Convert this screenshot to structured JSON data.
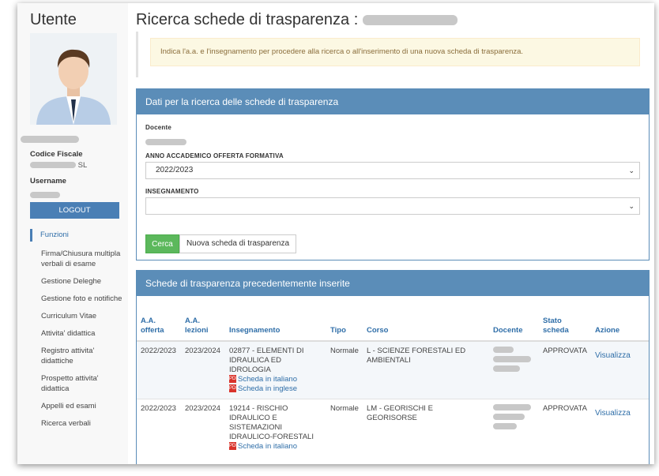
{
  "sidebar": {
    "title": "Utente",
    "codice_fiscale_label": "Codice Fiscale",
    "codice_fiscale_value": "SL",
    "username_label": "Username",
    "logout_label": "LOGOUT",
    "menu_header": "Funzioni",
    "menu_items": [
      "Firma/Chiusura multipla verbali di esame",
      "Gestione Deleghe",
      "Gestione foto e notifiche",
      "Curriculum Vitae",
      "Attivita' didattica",
      "Registro attivita' didattiche",
      "Prospetto attivita' didattica",
      "Appelli ed esami",
      "Ricerca verbali"
    ]
  },
  "main": {
    "title": "Ricerca schede di trasparenza :",
    "alert": "Indica l'a.a. e l'insegnamento per procedere alla ricerca o all'inserimento di una nuova scheda di trasparenza.",
    "search_panel": {
      "heading": "Dati per la ricerca delle schede di trasparenza",
      "docente_label": "Docente",
      "anno_label": "ANNO ACCADEMICO OFFERTA FORMATIVA",
      "anno_value": "2022/2023",
      "insegnamento_label": "INSEGNAMENTO",
      "insegnamento_value": "",
      "cerca_label": "Cerca",
      "new_label": "Nuova scheda di trasparenza"
    },
    "list_panel": {
      "heading": "Schede di trasparenza precedentemente inserite",
      "columns": {
        "aa_offerta": "A.A. offerta",
        "aa_lezioni": "A.A. lezioni",
        "insegnamento": "Insegnamento",
        "tipo": "Tipo",
        "corso": "Corso",
        "docente": "Docente",
        "stato": "Stato scheda",
        "azione": "Azione"
      },
      "rows": [
        {
          "aa_offerta": "2022/2023",
          "aa_lezioni": "2023/2024",
          "insegnamento": "02877 - ELEMENTI DI IDRAULICA ED IDROLOGIA",
          "link_it": "Scheda in italiano",
          "link_en": "Scheda in inglese",
          "tipo": "Normale",
          "corso": "L - SCIENZE FORESTALI ED AMBIENTALI",
          "stato": "APPROVATA",
          "azione": "Visualizza"
        },
        {
          "aa_offerta": "2022/2023",
          "aa_lezioni": "2023/2024",
          "insegnamento": "19214 - RISCHIO IDRAULICO E SISTEMAZIONI IDRAULICO-FORESTALI",
          "link_it": "Scheda in italiano",
          "tipo": "Normale",
          "corso": "LM - GEORISCHI E GEORISORSE",
          "stato": "APPROVATA",
          "azione": "Visualizza"
        }
      ]
    }
  },
  "icons": {
    "pdf": "pdf-file-icon",
    "select": "chevron-down-icon"
  },
  "colors": {
    "header_blue": "#5b8db8",
    "logout_blue": "#4a7fb5",
    "success_green": "#5cb85c",
    "alert_bg": "#fcf8e3"
  }
}
